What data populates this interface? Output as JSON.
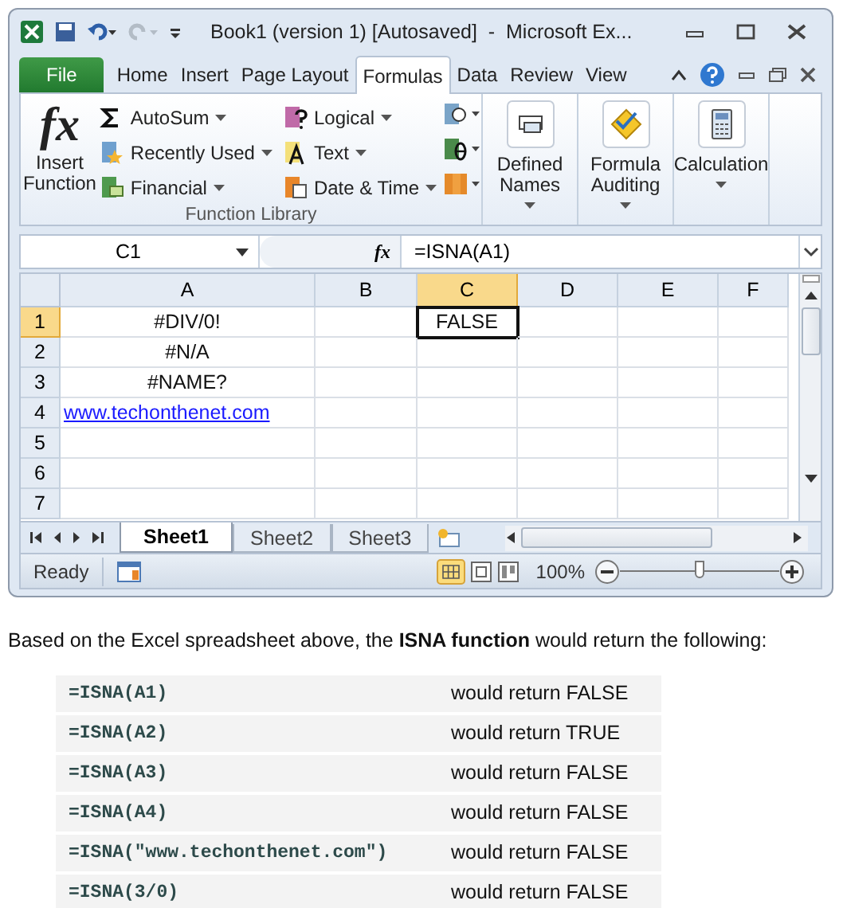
{
  "window": {
    "title": "Book1 (version 1) [Autosaved]  -  Microsoft Ex..."
  },
  "tabs": [
    {
      "label": "File",
      "selected": false,
      "kind": "file"
    },
    {
      "label": "Home",
      "selected": false,
      "kind": "tab"
    },
    {
      "label": "Insert",
      "selected": false,
      "kind": "tab"
    },
    {
      "label": "Page Layout",
      "selected": false,
      "kind": "tab"
    },
    {
      "label": "Formulas",
      "selected": true,
      "kind": "tab"
    },
    {
      "label": "Data",
      "selected": false,
      "kind": "tab"
    },
    {
      "label": "Review",
      "selected": false,
      "kind": "tab"
    },
    {
      "label": "View",
      "selected": false,
      "kind": "tab"
    }
  ],
  "ribbon": {
    "insert_function": {
      "symbol": "fx",
      "label_lines": [
        "Insert",
        "Function"
      ]
    },
    "function_columns": [
      [
        "AutoSum",
        "Recently Used",
        "Financial"
      ],
      [
        "Logical",
        "Text",
        "Date & Time"
      ]
    ],
    "group_label": "Function Library",
    "big_buttons": [
      {
        "label_lines": [
          "Defined",
          "Names"
        ]
      },
      {
        "label_lines": [
          "Formula",
          "Auditing"
        ]
      },
      {
        "label_lines": [
          "Calculation"
        ]
      }
    ]
  },
  "formula_bar": {
    "name_box": "C1",
    "fx": "fx",
    "formula": "=ISNA(A1)"
  },
  "grid": {
    "columns": [
      {
        "label": "A",
        "selected": false
      },
      {
        "label": "B",
        "selected": false
      },
      {
        "label": "C",
        "selected": true
      },
      {
        "label": "D",
        "selected": false
      },
      {
        "label": "E",
        "selected": false
      },
      {
        "label": "F",
        "selected": false
      }
    ],
    "rows": [
      {
        "header": "1",
        "selected": true,
        "cells": [
          {
            "text": "#DIV/0!",
            "kind": "text",
            "selected": false
          },
          {
            "text": "",
            "selected": false
          },
          {
            "text": "FALSE",
            "kind": "text",
            "selected": true
          }
        ]
      },
      {
        "header": "2",
        "selected": false,
        "cells": [
          {
            "text": "#N/A",
            "kind": "text",
            "selected": false
          }
        ]
      },
      {
        "header": "3",
        "selected": false,
        "cells": [
          {
            "text": "#NAME?",
            "kind": "text",
            "selected": false
          }
        ]
      },
      {
        "header": "4",
        "selected": false,
        "cells": [
          {
            "text": "www.techonthenet.com",
            "kind": "link",
            "selected": false
          }
        ]
      },
      {
        "header": "5",
        "selected": false,
        "cells": []
      },
      {
        "header": "6",
        "selected": false,
        "cells": []
      },
      {
        "header": "7",
        "selected": false,
        "cells": []
      }
    ]
  },
  "sheet_tabs": [
    {
      "label": "Sheet1",
      "selected": true
    },
    {
      "label": "Sheet2",
      "selected": false
    },
    {
      "label": "Sheet3",
      "selected": false
    }
  ],
  "status_bar": {
    "text": "Ready",
    "zoom": "100%",
    "zoom_slider": {
      "level": 0.5
    }
  },
  "article": {
    "intro": "Based on the Excel spreadsheet above, the **ISNA function** would return the following:",
    "examples": [
      {
        "formula": "=ISNA(A1)",
        "result": "would return FALSE"
      },
      {
        "formula": "=ISNA(A2)",
        "result": "would return TRUE"
      },
      {
        "formula": "=ISNA(A3)",
        "result": "would return FALSE"
      },
      {
        "formula": "=ISNA(A4)",
        "result": "would return FALSE"
      },
      {
        "formula": "=ISNA(\"www.techonthenet.com\")",
        "result": "would return FALSE"
      },
      {
        "formula": "=ISNA(3/0)",
        "result": "would return FALSE"
      }
    ]
  }
}
